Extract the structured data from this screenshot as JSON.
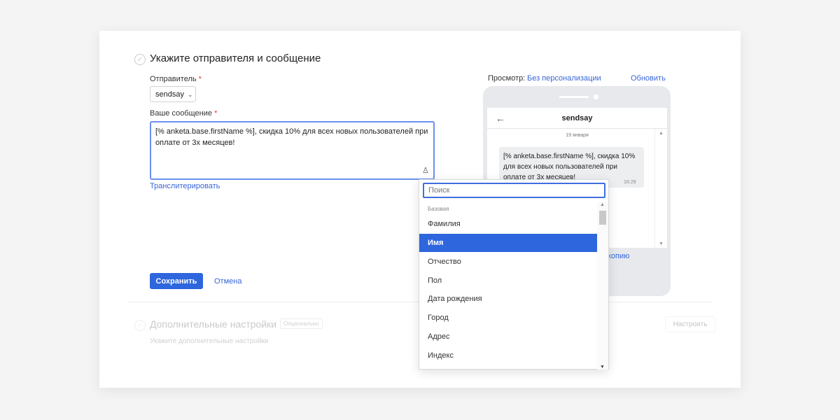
{
  "step": {
    "title": "Укажите отправителя и сообщение"
  },
  "sender": {
    "label": "Отправитель",
    "required_mark": "*",
    "value": "sendsay"
  },
  "message": {
    "label": "Ваше сообщение",
    "required_mark": "*",
    "text": "[% anketa.base.firstName %], скидка 10% для всех новых пользователей при оплате от 3х месяцев!"
  },
  "transliterate_link": "Транслитерировать",
  "actions": {
    "save": "Сохранить",
    "cancel": "Отмена"
  },
  "preview": {
    "label": "Просмотр:",
    "mode_link": "Без персонализации",
    "refresh_link": "Обновить",
    "phone_title": "sendsay",
    "date": "19 января",
    "bubble_text": "[% anketa.base.firstName %], скидка 10% для всех новых пользователей при оплате от 3х месяцев!",
    "time": "16:29",
    "copy_link_partial": "копию"
  },
  "additional": {
    "title": "Дополнительные настройки",
    "badge": "Опционально",
    "subtitle": "Укажите дополнительные настройки",
    "setup_button": "Настроить"
  },
  "dropdown": {
    "search_placeholder": "Поиск",
    "group_label": "Базовая",
    "options": [
      "Фамилия",
      "Имя",
      "Отчество",
      "Пол",
      "Дата рождения",
      "Город",
      "Адрес",
      "Индекс"
    ],
    "selected": "Имя"
  },
  "colors": {
    "accent": "#2e66dd",
    "link": "#3766d9",
    "required": "#e53935"
  }
}
